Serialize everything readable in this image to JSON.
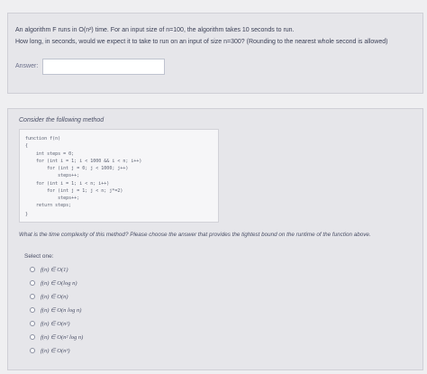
{
  "question1": {
    "line1": "An algorithm F runs in O(n²) time. For an input size of n=100, the algorithm takes 10 seconds to run.",
    "line2": "How long, in seconds, would we expect it to take to run on an input of size n=300? (Rounding to the nearest whole second is allowed)",
    "answer_label": "Answer:",
    "answer_value": ""
  },
  "question2": {
    "title": "Consider the following method",
    "code": [
      "function f(n)",
      "{",
      "    int steps = 0;",
      "    for (int i = 1; i < 1000 && i < n; i++)",
      "        for (int j = 0; j < 1000; j++)",
      "            steps++;",
      "    for (int i = 1; i < n; i++)",
      "        for (int j = 1; j < n; j*=2)",
      "            steps++;",
      "    return steps;",
      "}"
    ],
    "question": "What is the time complexity of this method? Please choose the answer that provides the tightest bound on the runtime of the function above.",
    "select_label": "Select one:",
    "options": [
      "f(n) ∈ O(1)",
      "f(n) ∈ O(log n)",
      "f(n) ∈ O(n)",
      "f(n) ∈ O(n log n)",
      "f(n) ∈ O(n²)",
      "f(n) ∈ O(n² log n)",
      "f(n) ∈ O(n³)"
    ]
  }
}
